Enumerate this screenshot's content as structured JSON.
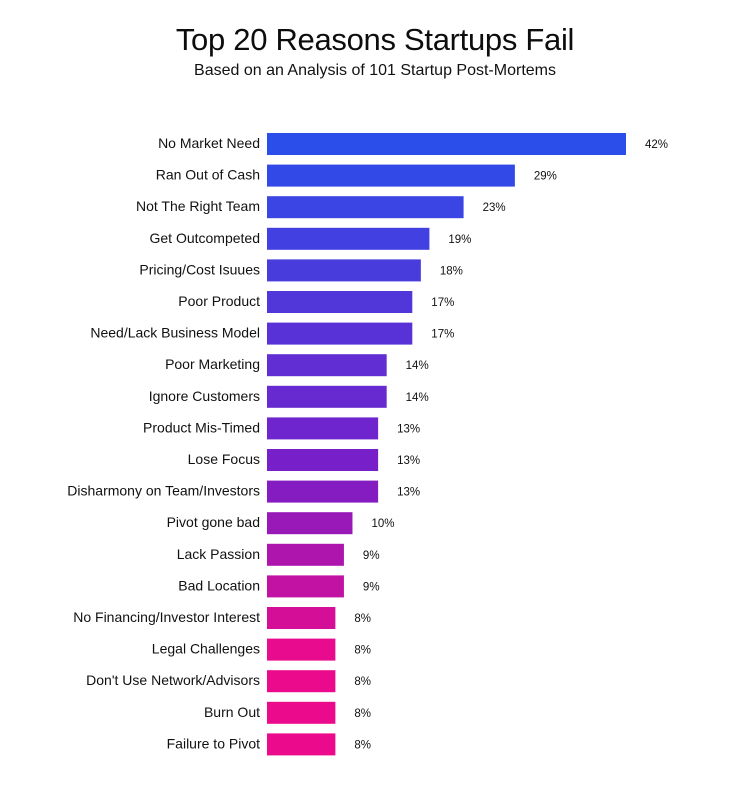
{
  "chart_data": {
    "type": "bar",
    "orientation": "horizontal",
    "title": "Top 20 Reasons Startups Fail",
    "subtitle": "Based on an Analysis of 101 Startup Post-Mortems",
    "xlabel": "",
    "ylabel": "",
    "xlim": [
      0,
      42
    ],
    "grid": false,
    "legend": "none",
    "value_suffix": "%",
    "categories": [
      "No Market Need",
      "Ran Out of Cash",
      "Not The Right Team",
      "Get Outcompeted",
      "Pricing/Cost Isuues",
      "Poor Product",
      "Need/Lack Business Model",
      "Poor Marketing",
      "Ignore Customers",
      "Product Mis-Timed",
      "Lose Focus",
      "Disharmony on Team/Investors",
      "Pivot gone bad",
      "Lack Passion",
      "Bad Location",
      "No Financing/Investor Interest",
      "Legal Challenges",
      "Don't Use Network/Advisors",
      "Burn Out",
      "Failure to Pivot"
    ],
    "values": [
      42,
      29,
      23,
      19,
      18,
      17,
      17,
      14,
      14,
      13,
      13,
      13,
      10,
      9,
      9,
      8,
      8,
      8,
      8,
      8
    ],
    "value_labels": [
      "42%",
      "29%",
      "23%",
      "19%",
      "18%",
      "17%",
      "17%",
      "14%",
      "14%",
      "13%",
      "13%",
      "13%",
      "10%",
      "9%",
      "9%",
      "8%",
      "8%",
      "8%",
      "8%",
      "8%"
    ],
    "colors": {
      "gradient_start": "#2B4EEA",
      "gradient_mid": "#7A1EC8",
      "gradient_end": "#EC0A8C"
    }
  }
}
